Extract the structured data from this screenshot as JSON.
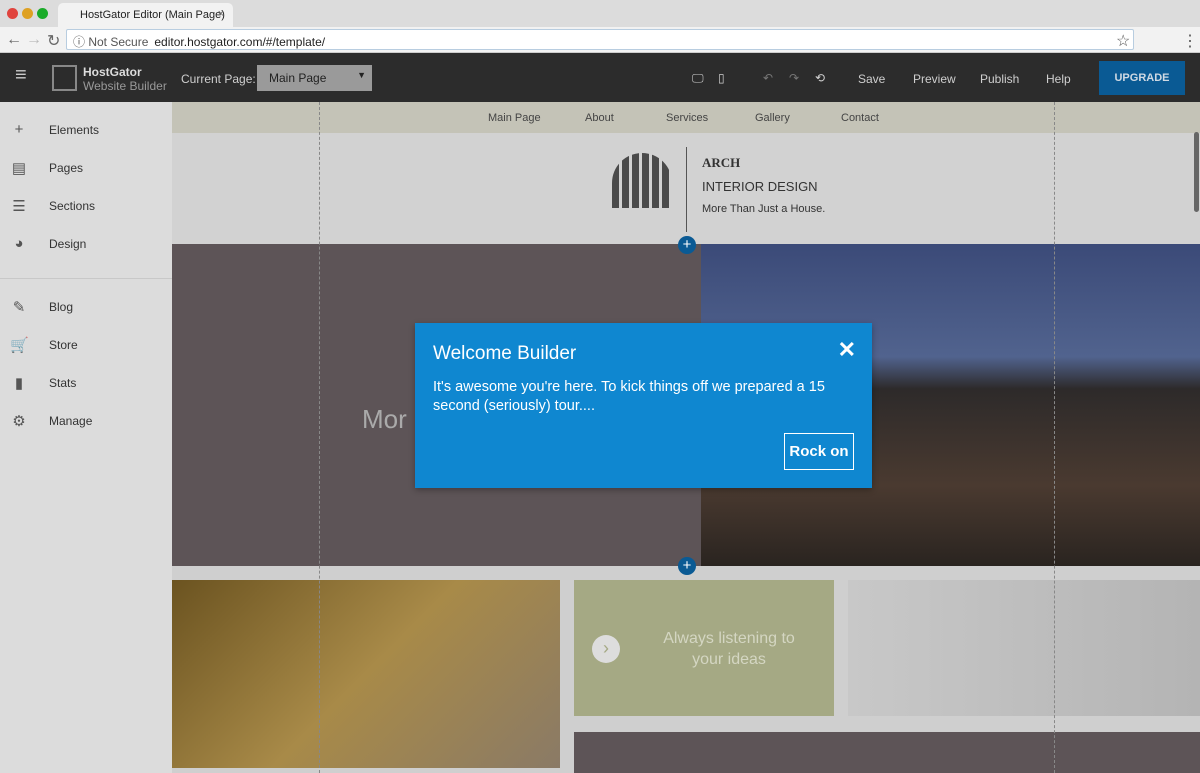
{
  "browser": {
    "tab_title": "HostGator Editor (Main Page)",
    "not_secure": "Not Secure",
    "url": "editor.hostgator.com/#/template/"
  },
  "toolbar": {
    "brand": "HostGator",
    "brand_sub": "Website Builder",
    "current_page_label": "Current Page:",
    "current_page": "Main Page",
    "save": "Save",
    "preview": "Preview",
    "publish": "Publish",
    "help": "Help",
    "upgrade": "UPGRADE"
  },
  "sidebar": {
    "items": [
      {
        "label": "Elements",
        "icon": "plus-icon"
      },
      {
        "label": "Pages",
        "icon": "pages-icon"
      },
      {
        "label": "Sections",
        "icon": "sections-icon"
      },
      {
        "label": "Design",
        "icon": "palette-icon"
      },
      {
        "label": "Blog",
        "icon": "pencil-icon"
      },
      {
        "label": "Store",
        "icon": "cart-icon"
      },
      {
        "label": "Stats",
        "icon": "bar-chart-icon"
      },
      {
        "label": "Manage",
        "icon": "gear-icon"
      }
    ]
  },
  "site": {
    "nav": [
      "Main Page",
      "About",
      "Services",
      "Gallery",
      "Contact"
    ],
    "logo_title": "ARCH",
    "logo_subtitle": "INTERIOR DESIGN",
    "tagline": "More Than Just a House.",
    "hero_text": "Mor",
    "tile_text": "Always listening to your ideas"
  },
  "dialog": {
    "title": "Welcome Builder",
    "body": "It's awesome you're here. To kick things off we prepared a 15 second (seriously) tour....",
    "button": "Rock on"
  },
  "colors": {
    "accent": "#0f87d0",
    "upgrade": "#0a5a94"
  }
}
